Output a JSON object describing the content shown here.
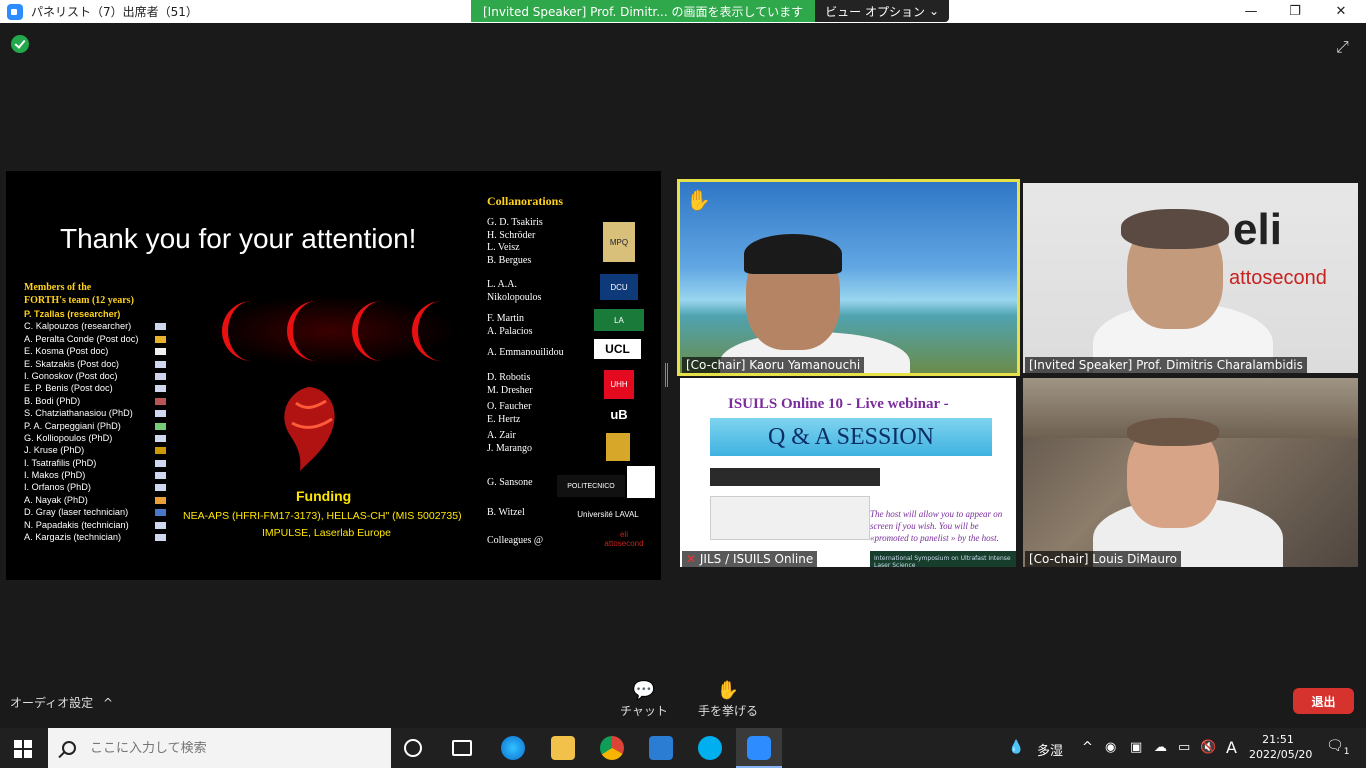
{
  "titlebar": {
    "title": "パネリスト（7）出席者（51）",
    "share_banner": "[Invited Speaker]  Prof. Dimitr... の画面を表示しています",
    "view_options": "ビュー オプション",
    "view_options_arrow": "⌄",
    "minimize": "—",
    "maximize": "❐",
    "close": "✕"
  },
  "slide": {
    "heading": "Thank you for your attention!",
    "members_title_1": "Members of the",
    "members_title_2": "FORTH's team (12 years)",
    "members": [
      "P. Tzallas  (researcher)",
      "C. Kalpouzos (researcher)",
      "A. Peralta Conde (Post doc)",
      "E. Kosma (Post doc)",
      "E. Skatzakis (Post doc)",
      "I. Gonoskov (Post doc)",
      "E. P. Benis (Post doc)",
      "B. Bodi  (PhD)",
      "S. Chatziathanasiou (PhD)",
      "P. A. Carpeggiani  (PhD)",
      "G. Kolliopoulos (PhD)",
      "J. Kruse (PhD)",
      "I. Tsatrafilis (PhD)",
      "I. Makos (PhD)",
      "I. Orfanos (PhD)",
      "A. Nayak (PhD)",
      "D. Gray (laser technician)",
      "N. Papadakis (technician)",
      "A. Kargazis (technician)"
    ],
    "funding_title": "Funding",
    "funding_line1": "NEA-APS (HFRI-FM17-3173), HELLAS-CH\" (MIS 5002735)",
    "funding_line2": "IMPULSE, Laserlab Europe",
    "collab_title": "Collanorations",
    "collab_groups": [
      "G. D. Tsakiris\nH. Schröder\nL. Veisz\nB. Bergues",
      "L. A.A.\nNikolopoulos",
      "F. Martin\nA.   Palacios",
      "A. Emmanouilidou",
      "D. Robotis\nM. Dresher",
      "O. Faucher\nE. Hertz",
      "A. Zair\nJ. Marango",
      "G. Sansone",
      "B. Witzel",
      "Colleagues @"
    ],
    "institutions": [
      "MPQ",
      "DCU",
      "LA",
      "UCL",
      "UHH",
      "uB",
      "POLITECNICO",
      "Université LAVAL",
      "eli attosecond"
    ]
  },
  "tiles": {
    "yamanouchi_label": "[Co-chair] Kaoru Yamanouchi",
    "raise_hand": "✋",
    "dimitris_label": "[Invited Speaker] Prof. Dimitris Charalambidis",
    "eli_logo": "eli",
    "eli_sub": "attosecond",
    "jils_label": "JILS / ISUILS Online",
    "qa_title": "ISUILS Online 10 - Live webinar -",
    "qa_box": "Q & A  SESSION",
    "qa_note": "The host will allow you to appear on screen if you wish. You will be «promoted to panelist » by the host.",
    "qa_strip": "International Symposium on Ultrafast Intense Laser Science",
    "louis_label": "[Co-chair] Louis DiMauro"
  },
  "controls": {
    "audio_settings": "オーディオ設定",
    "audio_arrow": "^",
    "chat": "チャット",
    "raise_hand": "手を挙げる",
    "leave": "退出"
  },
  "taskbar": {
    "search_placeholder": "ここに入力して検索",
    "weather": "多湿",
    "time": "21:51",
    "date": "2022/05/20",
    "ime": "A",
    "notifications": "1"
  }
}
